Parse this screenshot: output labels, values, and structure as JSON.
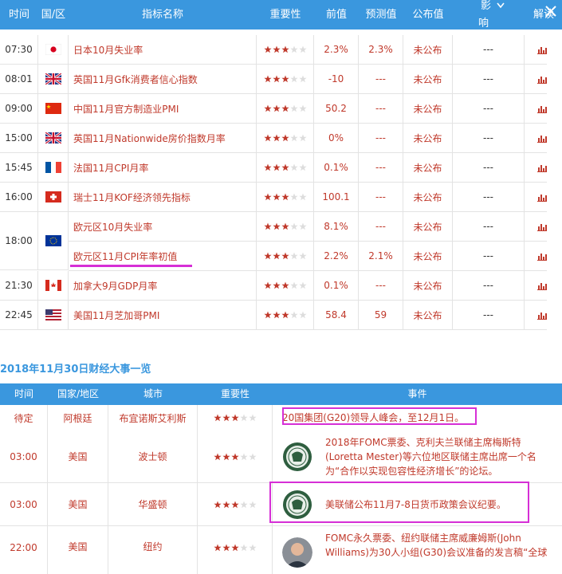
{
  "top_table": {
    "headers": {
      "time": "时间",
      "region": "国/区",
      "indicator": "指标名称",
      "importance": "重要性",
      "prev": "前值",
      "forecast": "预测值",
      "actual": "公布值",
      "impact_line1": "影",
      "impact_line2": "响",
      "analysis": "解读"
    },
    "rows": [
      {
        "time": "07:30",
        "flag": "japan-flag",
        "name": "日本10月失业率",
        "prev": "2.3%",
        "forecast": "2.3%",
        "actual": "未公布",
        "impact": "---"
      },
      {
        "time": "08:01",
        "flag": "uk-flag",
        "name": "英国11月Gfk消费者信心指数",
        "prev": "-10",
        "forecast": "---",
        "actual": "未公布",
        "impact": "---"
      },
      {
        "time": "09:00",
        "flag": "china-flag",
        "name": "中国11月官方制造业PMI",
        "prev": "50.2",
        "forecast": "---",
        "actual": "未公布",
        "impact": "---"
      },
      {
        "time": "15:00",
        "flag": "uk-flag",
        "name": "英国11月Nationwide房价指数月率",
        "prev": "0%",
        "forecast": "---",
        "actual": "未公布",
        "impact": "---"
      },
      {
        "time": "15:45",
        "flag": "france-flag",
        "name": "法国11月CPI月率",
        "prev": "0.1%",
        "forecast": "---",
        "actual": "未公布",
        "impact": "---"
      },
      {
        "time": "16:00",
        "flag": "switzerland-flag",
        "name": "瑞士11月KOF经济领先指标",
        "prev": "100.1",
        "forecast": "---",
        "actual": "未公布",
        "impact": "---"
      },
      {
        "time": "18:00",
        "flag": "eu-flag",
        "name": "欧元区10月失业率",
        "prev": "8.1%",
        "forecast": "---",
        "actual": "未公布",
        "impact": "---"
      },
      {
        "time": "",
        "flag": "",
        "name": "欧元区11月CPI年率初值",
        "prev": "2.2%",
        "forecast": "2.1%",
        "actual": "未公布",
        "impact": "---"
      },
      {
        "time": "21:30",
        "flag": "canada-flag",
        "name": "加拿大9月GDP月率",
        "prev": "0.1%",
        "forecast": "---",
        "actual": "未公布",
        "impact": "---"
      },
      {
        "time": "22:45",
        "flag": "usa-flag",
        "name": "美国11月芝加哥PMI",
        "prev": "58.4",
        "forecast": "59",
        "actual": "未公布",
        "impact": "---"
      }
    ]
  },
  "events_section": {
    "title": "2018年11月30日财经大事一览",
    "headers": {
      "time": "时间",
      "region": "国家/地区",
      "city": "城市",
      "importance": "重要性",
      "event": "事件"
    },
    "rows": [
      {
        "time": "待定",
        "region": "阿根廷",
        "city": "布宜诺斯艾利斯",
        "event": "20国集团(G20)领导人峰会，至12月1日。",
        "avatar": ""
      },
      {
        "time": "03:00",
        "region": "美国",
        "city": "波士顿",
        "event": "2018年FOMC票委、克利夫兰联储主席梅斯特(Loretta Mester)等六位地区联储主席出席一个名为“合作以实现包容性经济增长”的论坛。",
        "avatar": "fed-seal-icon"
      },
      {
        "time": "03:00",
        "region": "美国",
        "city": "华盛顿",
        "event": "美联储公布11月7-8日货币政策会议纪要。",
        "avatar": "fed-seal-icon"
      },
      {
        "time": "22:00",
        "region": "美国",
        "city": "纽约",
        "event": "FOMC永久票委、纽约联储主席威廉姆斯(John Williams)为30人小组(G30)会议准备的发言稿“全球",
        "avatar": "person-photo"
      }
    ]
  },
  "colors": {
    "header": "#3a97de",
    "accent_red": "#c0392b",
    "highlight": "#d62fd6",
    "star_on": "#c0392b",
    "star_off": "#dddddd"
  }
}
